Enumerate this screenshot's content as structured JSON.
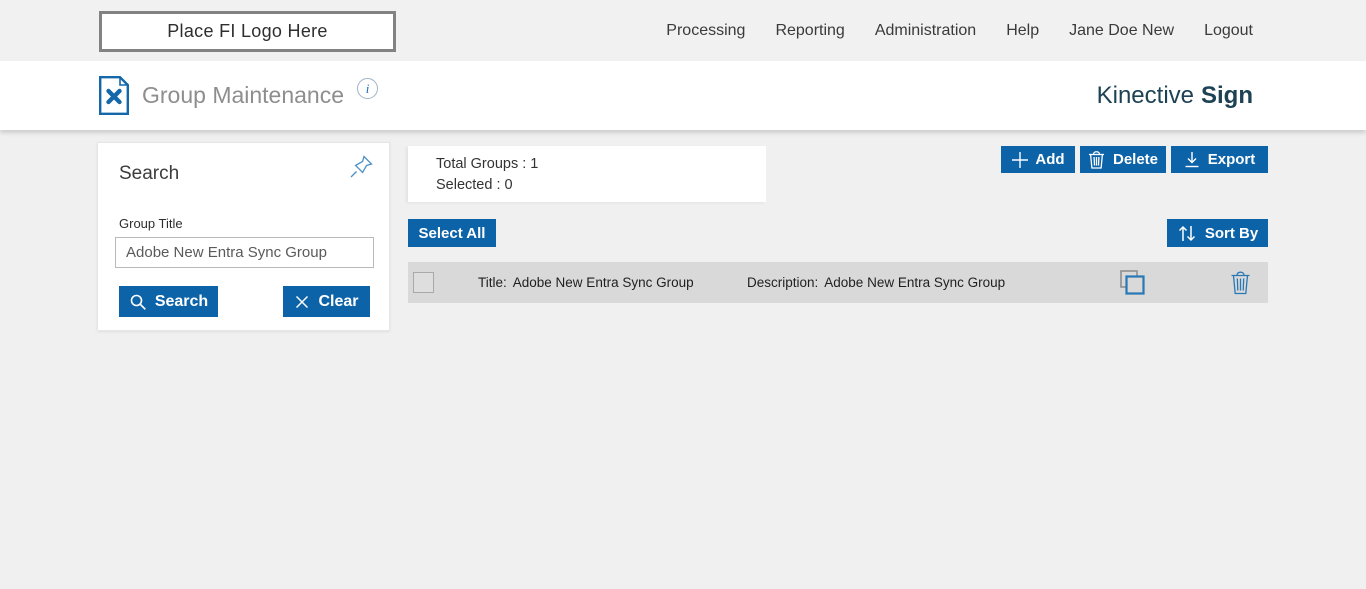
{
  "topbar": {
    "logo_text": "Place FI Logo Here",
    "nav": [
      "Processing",
      "Reporting",
      "Administration",
      "Help",
      "Jane Doe New",
      "Logout"
    ]
  },
  "header": {
    "title": "Group Maintenance",
    "brand": {
      "regular": "Kinective",
      "bold": "Sign"
    }
  },
  "search_panel": {
    "title": "Search",
    "group_title_label": "Group Title",
    "group_title_value": "Adobe New Entra Sync Group",
    "search_button": "Search",
    "clear_button": "Clear"
  },
  "summary": {
    "total_groups": "Total Groups : 1",
    "selected": "Selected : 0"
  },
  "toolbar": {
    "add": "Add",
    "delete": "Delete",
    "export": "Export",
    "select_all": "Select All",
    "sort_by": "Sort By"
  },
  "groups": [
    {
      "title_label": "Title:",
      "title": "Adobe New Entra Sync Group",
      "description_label": "Description:",
      "description": "Adobe New Entra Sync Group",
      "checked": false
    }
  ],
  "icons": {
    "page_tools_icon": "document-with-crossed-tools",
    "info_glyph": "i",
    "pin_icon": "pushpin-outline",
    "search_icon": "magnifier",
    "clear_icon": "x-cross",
    "add_icon": "plus",
    "delete_icon": "trash-can",
    "export_icon": "download-arrow",
    "sort_icon": "up-down-arrows",
    "copy_icon": "overlapping-squares",
    "row_delete_icon": "trash-can"
  },
  "colors": {
    "accent_blue": "#0d63a8",
    "brand_teal": "#1c4253",
    "icon_blue": "#2878b5",
    "topbar_bg": "#f1f1f1",
    "content_bg": "#f0f0f0",
    "row_bg": "#d9d9d9"
  }
}
